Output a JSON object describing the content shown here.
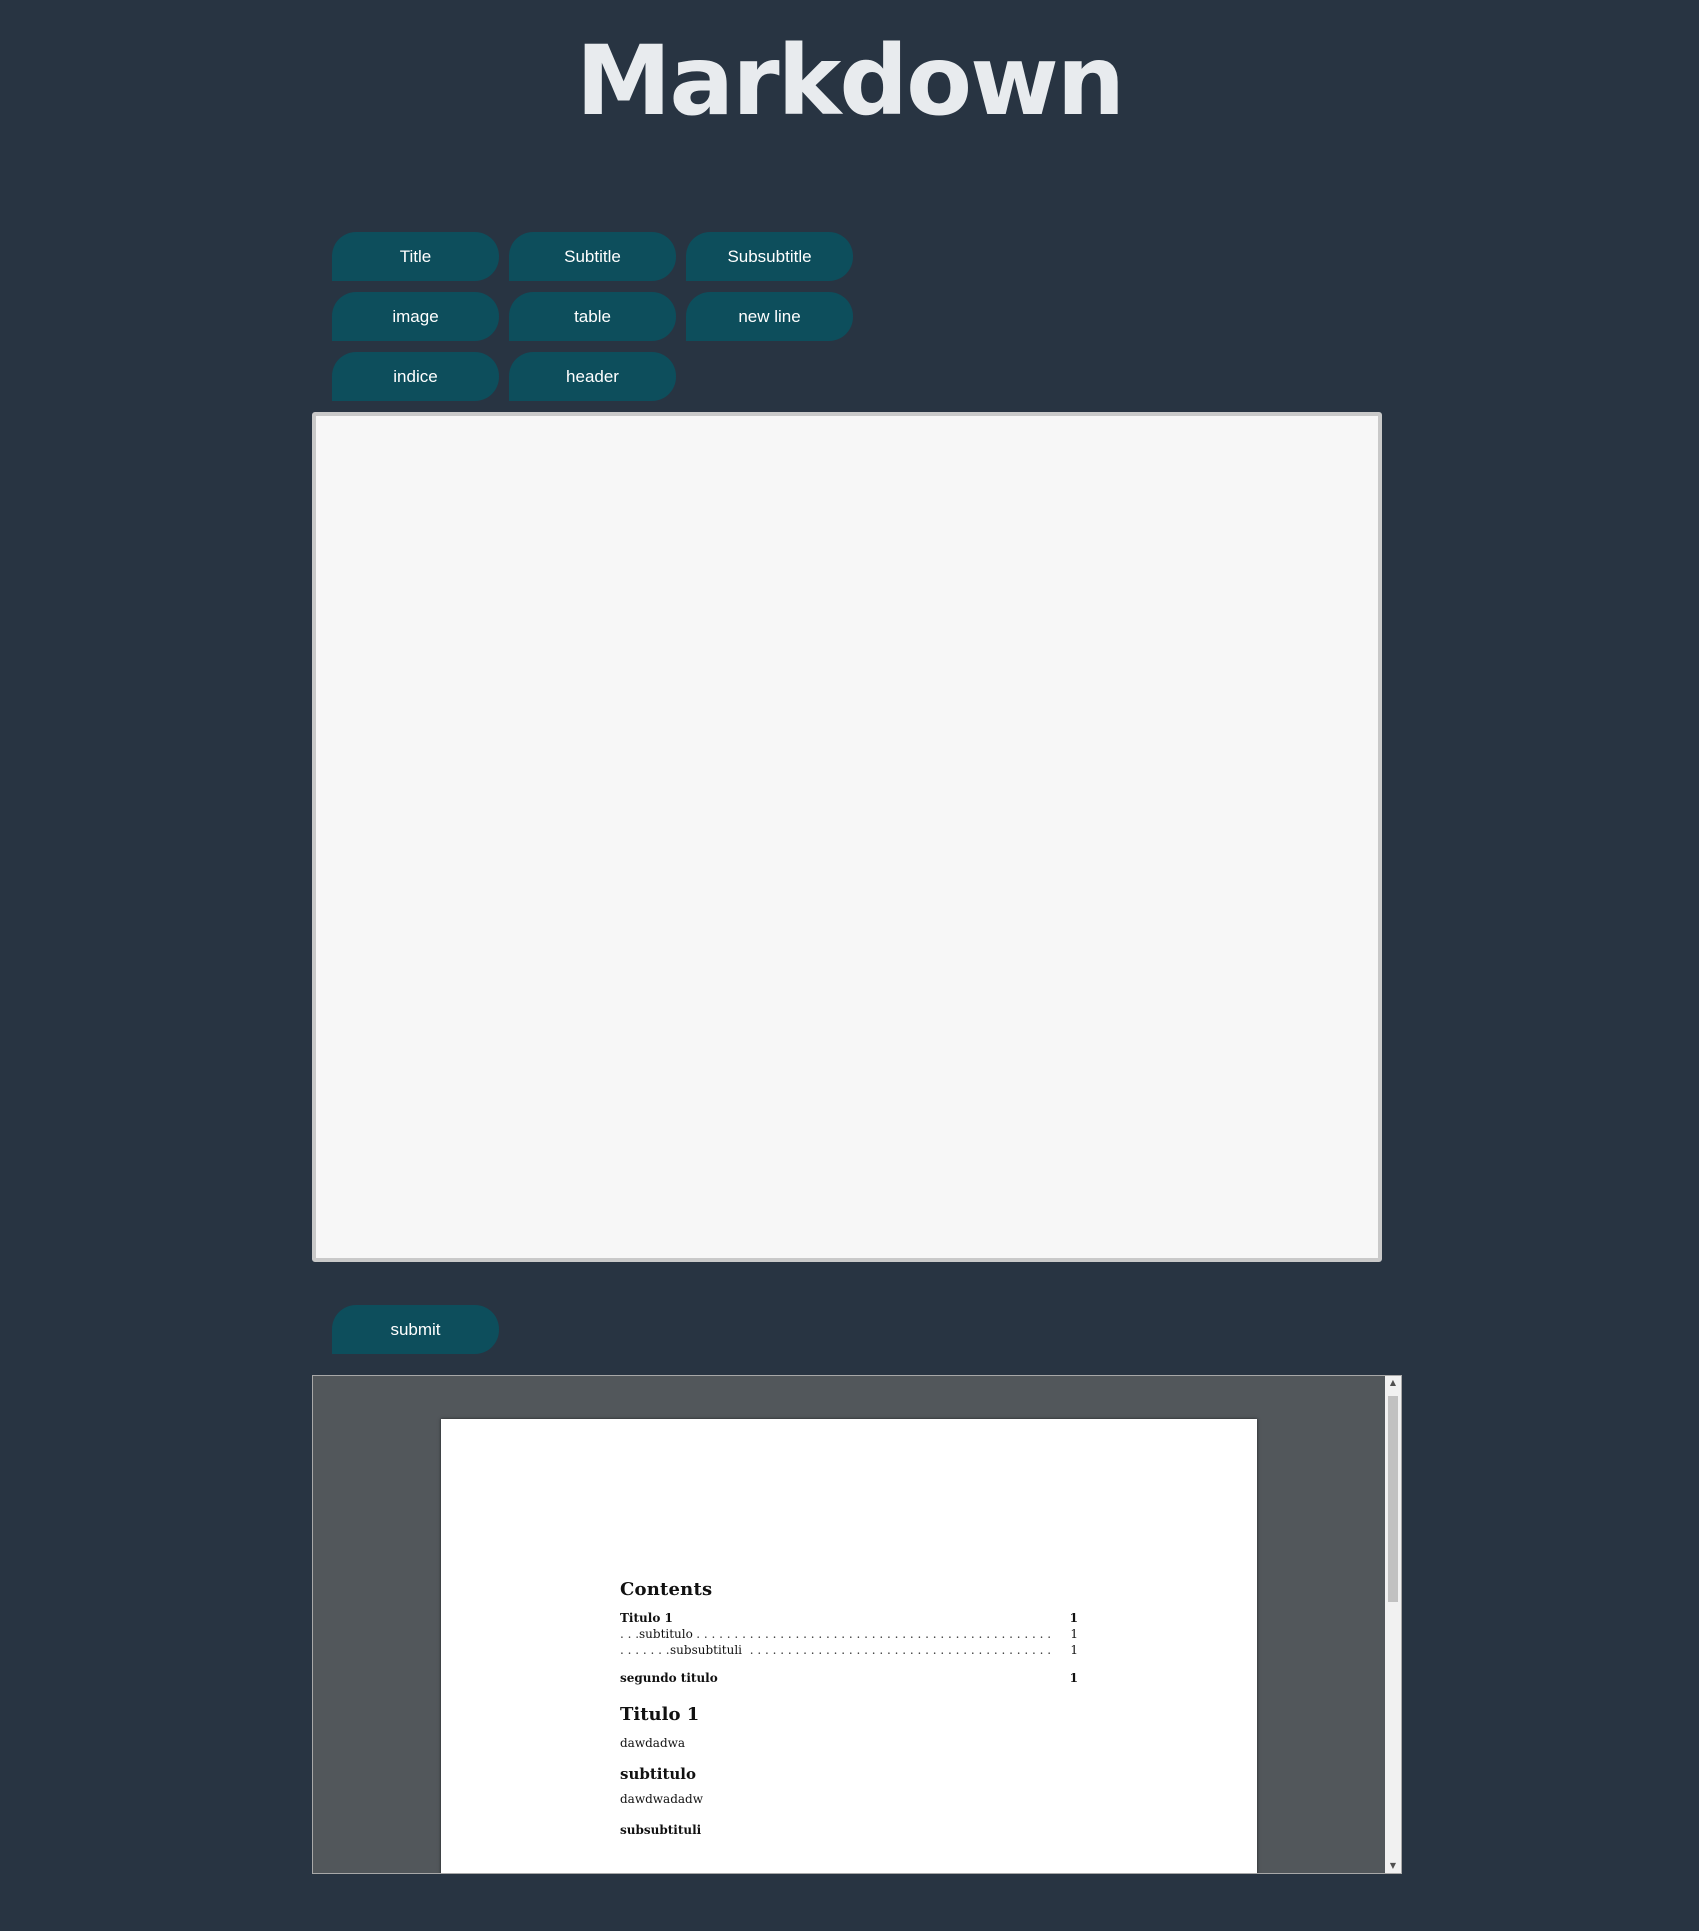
{
  "header": {
    "title": "Markdown"
  },
  "toolbar": {
    "buttons": [
      {
        "label": "Title"
      },
      {
        "label": "Subtitle"
      },
      {
        "label": "Subsubtitle"
      },
      {
        "label": "image"
      },
      {
        "label": "table"
      },
      {
        "label": "new line"
      },
      {
        "label": "indice"
      },
      {
        "label": "header"
      }
    ]
  },
  "editor": {
    "value": ""
  },
  "submit": {
    "label": "submit"
  },
  "preview": {
    "toc": {
      "heading": "Contents",
      "entries": [
        {
          "label": "Titulo 1",
          "page": "1"
        },
        {
          "label": "subtitulo",
          "page": "1"
        },
        {
          "label": "subsubtituli",
          "page": "1"
        },
        {
          "label": "segundo titulo",
          "page": "1"
        }
      ]
    },
    "sections": {
      "title1": "Titulo 1",
      "text1": "dawdadwa",
      "subtitle": "subtitulo",
      "text2": "dawdwadadw",
      "subsubtitle": "subsubtituli"
    },
    "scroll_up_glyph": "▲",
    "scroll_down_glyph": "▼"
  },
  "colors": {
    "background": "#283442",
    "button": "#0d4e5c",
    "title_text": "#e8ebee",
    "editor_bg": "#f7f7f7",
    "viewer_bg": "#52575b"
  }
}
